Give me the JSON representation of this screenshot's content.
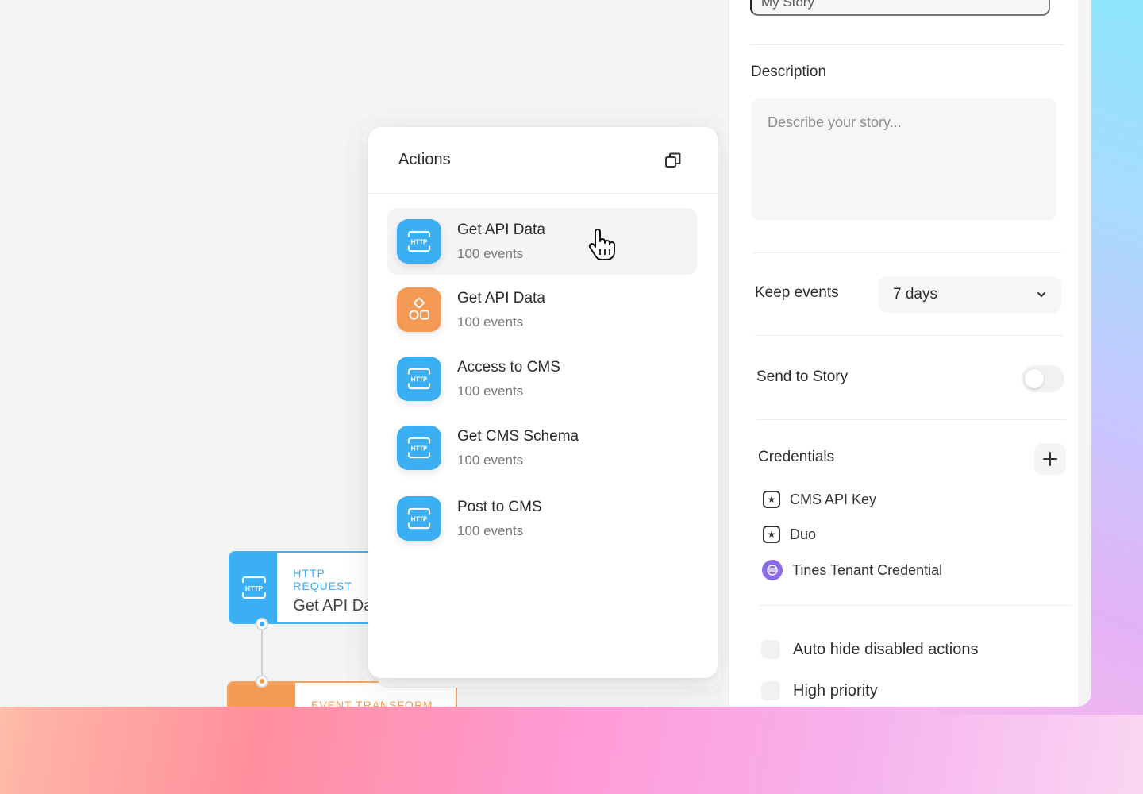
{
  "colors": {
    "http_blue": "#3aaff3",
    "transform_orange": "#f49a55",
    "tenant_purple": "#8b6bea"
  },
  "panel": {
    "name_value": "My Story",
    "description_label": "Description",
    "description_placeholder": "Describe your story...",
    "keep_events_label": "Keep events",
    "keep_events_value": "7 days",
    "send_to_story_label": "Send to Story",
    "send_to_story_on": false,
    "credentials_label": "Credentials",
    "credentials": [
      {
        "name": "CMS API Key",
        "icon": "star-icon"
      },
      {
        "name": "Duo",
        "icon": "star-icon"
      },
      {
        "name": "Tines Tenant Credential",
        "icon": "tenant-icon"
      }
    ],
    "auto_hide_label": "Auto hide disabled actions",
    "high_priority_label": "High priority"
  },
  "actions_popover": {
    "title": "Actions",
    "items": [
      {
        "name": "Get API Data",
        "count": "100 events",
        "icon": "http-icon",
        "active": true
      },
      {
        "name": "Get API Data",
        "count": "100 events",
        "icon": "transform-shapes-icon",
        "active": false
      },
      {
        "name": "Access to CMS",
        "count": "100 events",
        "icon": "http-icon",
        "active": false
      },
      {
        "name": "Get CMS Schema",
        "count": "100 events",
        "icon": "http-icon",
        "active": false
      },
      {
        "name": "Post to CMS",
        "count": "100 events",
        "icon": "http-icon",
        "active": false
      }
    ]
  },
  "canvas": {
    "node_http": {
      "type": "HTTP REQUEST",
      "name": "Get API Data"
    },
    "node_transform": {
      "type": "EVENT TRANSFORM"
    }
  }
}
